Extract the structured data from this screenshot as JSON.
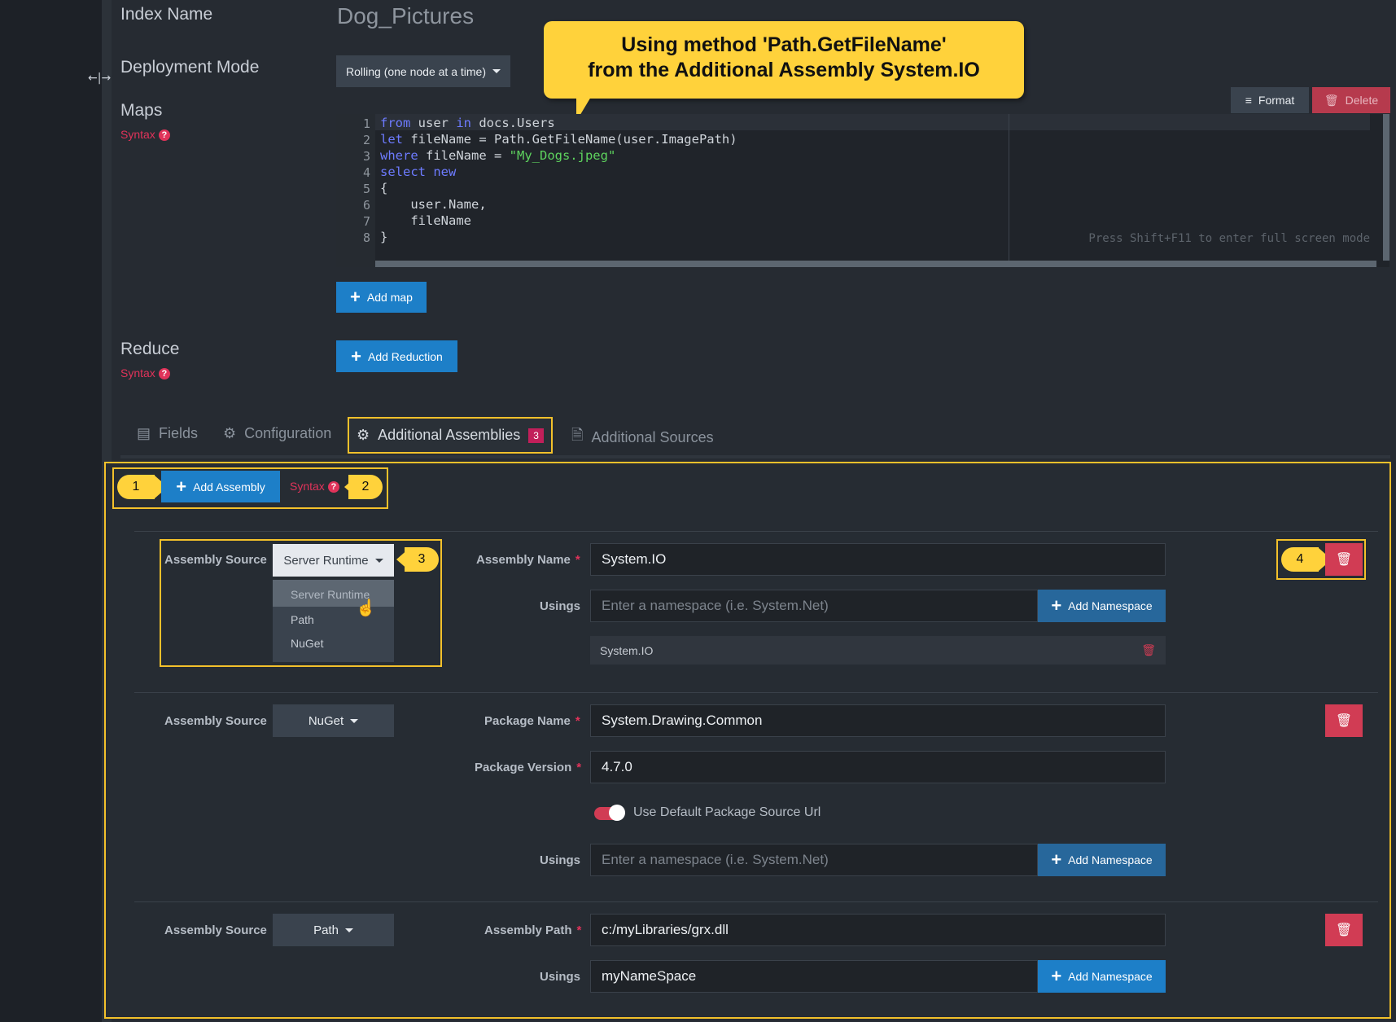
{
  "index": {
    "label": "Index Name",
    "value": "Dog_Pictures"
  },
  "deployment": {
    "label": "Deployment Mode",
    "value": "Rolling (one node at a time)"
  },
  "maps": {
    "label": "Maps",
    "syntax": "Syntax"
  },
  "callout": {
    "line1": "Using method 'Path.GetFileName'",
    "line2": "from the Additional Assembly System.IO"
  },
  "editor": {
    "format": "Format",
    "delete": "Delete",
    "hint": "Press Shift+F11 to enter full screen mode",
    "lines": [
      {
        "n": "1",
        "text": "from user in docs.Users"
      },
      {
        "n": "2",
        "text": "let fileName = Path.GetFileName(user.ImagePath)"
      },
      {
        "n": "3",
        "text": "where fileName = \"My_Dogs.jpeg\""
      },
      {
        "n": "4",
        "text": "select new"
      },
      {
        "n": "5",
        "text": "{"
      },
      {
        "n": "6",
        "text": "    user.Name,"
      },
      {
        "n": "7",
        "text": "    fileName"
      },
      {
        "n": "8",
        "text": "}"
      }
    ]
  },
  "add_map": "Add map",
  "reduce": {
    "label": "Reduce",
    "syntax": "Syntax",
    "button": "Add Reduction"
  },
  "tabs": [
    {
      "label": "Fields",
      "icon": "list-icon"
    },
    {
      "label": "Configuration",
      "icon": "gear-icon"
    },
    {
      "label": "Additional Assemblies",
      "icon": "gears-icon",
      "badge": "3"
    },
    {
      "label": "Additional Sources",
      "icon": "file-icon"
    }
  ],
  "panel": {
    "add_assembly": "Add Assembly",
    "syntax": "Syntax",
    "markers": [
      "1",
      "2",
      "3",
      "4"
    ]
  },
  "assembly1": {
    "source_label": "Assembly Source",
    "source_value": "Server Runtime",
    "dropdown_options": [
      "Server Runtime",
      "Path",
      "NuGet"
    ],
    "name_label": "Assembly Name",
    "name_value": "System.IO",
    "usings_label": "Usings",
    "usings_placeholder": "Enter a namespace (i.e. System.Net)",
    "add_namespace": "Add Namespace",
    "using_item": "System.IO"
  },
  "assembly2": {
    "source_label": "Assembly Source",
    "source_value": "NuGet",
    "package_label": "Package Name",
    "package_value": "System.Drawing.Common",
    "version_label": "Package Version",
    "version_value": "4.7.0",
    "toggle_label": "Use Default Package Source Url",
    "toggle_on": true,
    "usings_label": "Usings",
    "usings_placeholder": "Enter a namespace (i.e. System.Net)",
    "add_namespace": "Add Namespace"
  },
  "assembly3": {
    "source_label": "Assembly Source",
    "source_value": "Path",
    "path_label": "Assembly Path",
    "path_value": "c:/myLibraries/grx.dll",
    "usings_label": "Usings",
    "usings_value": "myNameSpace",
    "add_namespace": "Add Namespace"
  },
  "colors": {
    "accent": "#1d7fc8",
    "danger": "#d13c54",
    "highlight": "#ffd23b"
  }
}
